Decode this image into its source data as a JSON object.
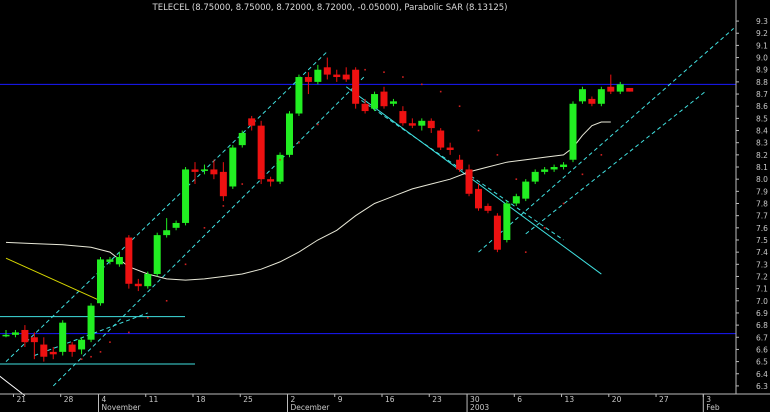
{
  "chart_data": {
    "type": "candlestick",
    "title": "TELECEL (8.75000, 8.75000, 8.72000, 8.72000, -0.05000), Parabolic SAR (8.13125)",
    "ylim": [
      6.25,
      9.35
    ],
    "y_ticks": [
      6.3,
      6.4,
      6.5,
      6.6,
      6.7,
      6.8,
      6.9,
      7.0,
      7.1,
      7.2,
      7.3,
      7.4,
      7.5,
      7.6,
      7.7,
      7.8,
      7.9,
      8.0,
      8.1,
      8.2,
      8.3,
      8.4,
      8.5,
      8.6,
      8.7,
      8.8,
      8.9,
      9.0,
      9.1,
      9.2,
      9.3
    ],
    "x_ticks": [
      {
        "label": "21",
        "i": 1
      },
      {
        "label": "28",
        "i": 6
      },
      {
        "label": "4",
        "i": 10
      },
      {
        "label": "11",
        "i": 15
      },
      {
        "label": "18",
        "i": 20
      },
      {
        "label": "25",
        "i": 25
      },
      {
        "label": "2",
        "i": 30
      },
      {
        "label": "9",
        "i": 35
      },
      {
        "label": "16",
        "i": 40
      },
      {
        "label": "23",
        "i": 45
      },
      {
        "label": "30",
        "i": 49
      },
      {
        "label": "6",
        "i": 54
      },
      {
        "label": "13",
        "i": 59
      },
      {
        "label": "20",
        "i": 64
      },
      {
        "label": "27",
        "i": 69
      },
      {
        "label": "3",
        "i": 74
      }
    ],
    "month_labels": [
      {
        "label": "November",
        "i": 10
      },
      {
        "label": "December",
        "i": 30
      },
      {
        "label": "2003",
        "i": 49
      },
      {
        "label": "Feb",
        "i": 74
      }
    ],
    "candles": [
      [
        6.72,
        6.76,
        6.7,
        6.72
      ],
      [
        6.72,
        6.76,
        6.7,
        6.74
      ],
      [
        6.76,
        6.8,
        6.62,
        6.66
      ],
      [
        6.7,
        6.74,
        6.52,
        6.66
      ],
      [
        6.64,
        6.7,
        6.5,
        6.54
      ],
      [
        6.58,
        6.62,
        6.52,
        6.56
      ],
      [
        6.58,
        6.84,
        6.55,
        6.82
      ],
      [
        6.64,
        6.66,
        6.54,
        6.58
      ],
      [
        6.6,
        6.7,
        6.56,
        6.68
      ],
      [
        6.68,
        6.98,
        6.66,
        6.96
      ],
      [
        6.98,
        7.36,
        6.96,
        7.34
      ],
      [
        7.32,
        7.36,
        7.3,
        7.34
      ],
      [
        7.3,
        7.4,
        7.28,
        7.36
      ],
      [
        7.52,
        7.54,
        7.1,
        7.14
      ],
      [
        7.14,
        7.18,
        7.08,
        7.12
      ],
      [
        7.12,
        7.24,
        7.1,
        7.22
      ],
      [
        7.22,
        7.56,
        7.2,
        7.54
      ],
      [
        7.54,
        7.68,
        7.52,
        7.58
      ],
      [
        7.6,
        7.66,
        7.58,
        7.64
      ],
      [
        7.64,
        8.1,
        7.62,
        8.08
      ],
      [
        8.08,
        8.14,
        7.96,
        8.06
      ],
      [
        8.08,
        8.12,
        8.04,
        8.08
      ],
      [
        8.08,
        8.16,
        8.0,
        8.04
      ],
      [
        8.06,
        8.14,
        7.82,
        7.86
      ],
      [
        7.94,
        8.28,
        7.92,
        8.26
      ],
      [
        8.28,
        8.4,
        8.26,
        8.38
      ],
      [
        8.5,
        8.52,
        8.4,
        8.44
      ],
      [
        8.44,
        8.48,
        7.96,
        8.0
      ],
      [
        8.0,
        8.02,
        7.94,
        7.98
      ],
      [
        7.98,
        8.22,
        7.96,
        8.2
      ],
      [
        8.2,
        8.56,
        8.18,
        8.54
      ],
      [
        8.54,
        8.86,
        8.52,
        8.84
      ],
      [
        8.84,
        8.88,
        8.7,
        8.8
      ],
      [
        8.8,
        8.94,
        8.78,
        8.9
      ],
      [
        8.92,
        9.0,
        8.82,
        8.86
      ],
      [
        8.86,
        8.9,
        8.8,
        8.84
      ],
      [
        8.86,
        8.92,
        8.8,
        8.82
      ],
      [
        8.9,
        8.92,
        8.58,
        8.62
      ],
      [
        8.62,
        8.66,
        8.54,
        8.56
      ],
      [
        8.58,
        8.72,
        8.56,
        8.7
      ],
      [
        8.72,
        8.76,
        8.58,
        8.6
      ],
      [
        8.62,
        8.66,
        8.6,
        8.64
      ],
      [
        8.56,
        8.6,
        8.44,
        8.46
      ],
      [
        8.46,
        8.5,
        8.42,
        8.44
      ],
      [
        8.44,
        8.5,
        8.4,
        8.48
      ],
      [
        8.48,
        8.5,
        8.38,
        8.42
      ],
      [
        8.4,
        8.42,
        8.24,
        8.26
      ],
      [
        8.26,
        8.3,
        8.2,
        8.24
      ],
      [
        8.16,
        8.2,
        8.06,
        8.08
      ],
      [
        8.08,
        8.12,
        7.86,
        7.88
      ],
      [
        7.92,
        7.96,
        7.74,
        7.76
      ],
      [
        7.78,
        7.8,
        7.72,
        7.74
      ],
      [
        7.7,
        7.72,
        7.4,
        7.42
      ],
      [
        7.5,
        7.82,
        7.48,
        7.8
      ],
      [
        7.8,
        7.88,
        7.78,
        7.86
      ],
      [
        7.84,
        8.0,
        7.82,
        7.98
      ],
      [
        7.98,
        8.08,
        7.96,
        8.06
      ],
      [
        8.06,
        8.1,
        8.04,
        8.08
      ],
      [
        8.08,
        8.12,
        8.06,
        8.1
      ],
      [
        8.1,
        8.14,
        8.08,
        8.12
      ],
      [
        8.16,
        8.64,
        8.14,
        8.62
      ],
      [
        8.64,
        8.76,
        8.62,
        8.74
      ],
      [
        8.66,
        8.68,
        8.6,
        8.62
      ],
      [
        8.62,
        8.76,
        8.6,
        8.74
      ],
      [
        8.76,
        8.86,
        8.7,
        8.72
      ],
      [
        8.72,
        8.8,
        8.7,
        8.78
      ],
      [
        8.75,
        8.75,
        8.72,
        8.72
      ]
    ],
    "moving_average": [
      [
        0,
        7.48
      ],
      [
        3,
        7.47
      ],
      [
        6,
        7.46
      ],
      [
        9,
        7.44
      ],
      [
        11,
        7.4
      ],
      [
        13,
        7.28
      ],
      [
        15,
        7.22
      ],
      [
        17,
        7.18
      ],
      [
        19,
        7.17
      ],
      [
        21,
        7.18
      ],
      [
        23,
        7.2
      ],
      [
        25,
        7.22
      ],
      [
        27,
        7.26
      ],
      [
        29,
        7.32
      ],
      [
        31,
        7.4
      ],
      [
        33,
        7.5
      ],
      [
        35,
        7.58
      ],
      [
        37,
        7.7
      ],
      [
        39,
        7.8
      ],
      [
        41,
        7.86
      ],
      [
        43,
        7.92
      ],
      [
        45,
        7.96
      ],
      [
        47,
        8.0
      ],
      [
        49,
        8.06
      ],
      [
        51,
        8.1
      ],
      [
        53,
        8.14
      ],
      [
        55,
        8.16
      ],
      [
        57,
        8.18
      ],
      [
        59,
        8.2
      ],
      [
        60,
        8.26
      ],
      [
        61,
        8.36
      ],
      [
        62,
        8.44
      ],
      [
        63,
        8.47
      ],
      [
        64,
        8.47
      ]
    ],
    "sar": [
      [
        8,
        6.52
      ],
      [
        9,
        6.54
      ],
      [
        10,
        6.58
      ],
      [
        11,
        6.66
      ],
      [
        13,
        6.74
      ],
      [
        15,
        6.86
      ],
      [
        17,
        7.0
      ],
      [
        19,
        7.3
      ],
      [
        21,
        7.6
      ],
      [
        23,
        7.78
      ],
      [
        25,
        7.96
      ],
      [
        27,
        8.06
      ],
      [
        29,
        8.16
      ],
      [
        31,
        8.3
      ],
      [
        33,
        8.45
      ],
      [
        38,
        8.9
      ],
      [
        40,
        8.88
      ],
      [
        42,
        8.84
      ],
      [
        44,
        8.78
      ],
      [
        46,
        8.72
      ],
      [
        48,
        8.6
      ],
      [
        50,
        8.4
      ],
      [
        52,
        8.2
      ],
      [
        54,
        8.0
      ],
      [
        55,
        7.4
      ],
      [
        57,
        7.6
      ],
      [
        59,
        7.8
      ],
      [
        61,
        8.04
      ],
      [
        63,
        8.2
      ]
    ],
    "horizontal_lines": [
      8.78,
      6.73,
      6.87,
      6.48
    ],
    "trend_lines": [
      {
        "from": [
          3,
          6.55
        ],
        "to": [
          15,
          6.9
        ],
        "dashed": true
      },
      {
        "from": [
          5,
          6.3
        ],
        "to": [
          38,
          8.85
        ],
        "dashed": true
      },
      {
        "from": [
          0,
          6.5
        ],
        "to": [
          34,
          9.05
        ],
        "dashed": true
      },
      {
        "from": [
          0,
          7.35
        ],
        "to": [
          10,
          7.0
        ],
        "dashed": false
      },
      {
        "from": [
          -1,
          6.4
        ],
        "to": [
          2,
          6.22
        ],
        "dashed": false
      },
      {
        "from": [
          36,
          8.76
        ],
        "to": [
          63,
          7.22
        ],
        "dashed": false
      },
      {
        "from": [
          37,
          8.68
        ],
        "to": [
          59,
          7.5
        ],
        "dashed": true
      },
      {
        "from": [
          50,
          7.4
        ],
        "to": [
          77,
          9.24
        ],
        "dashed": true
      },
      {
        "from": [
          55,
          7.55
        ],
        "to": [
          74,
          8.72
        ],
        "dashed": true
      }
    ],
    "colors": {
      "up": "#22ee22",
      "down": "#ee1111",
      "ma": "#e8e8d8",
      "sar": "#ffffff",
      "hline": "#1a1aff",
      "hline_cyan": "#40e0e0",
      "trend": "#40e0e0",
      "trend_yellow": "#d8d800",
      "sar_red": "#d02020"
    }
  }
}
